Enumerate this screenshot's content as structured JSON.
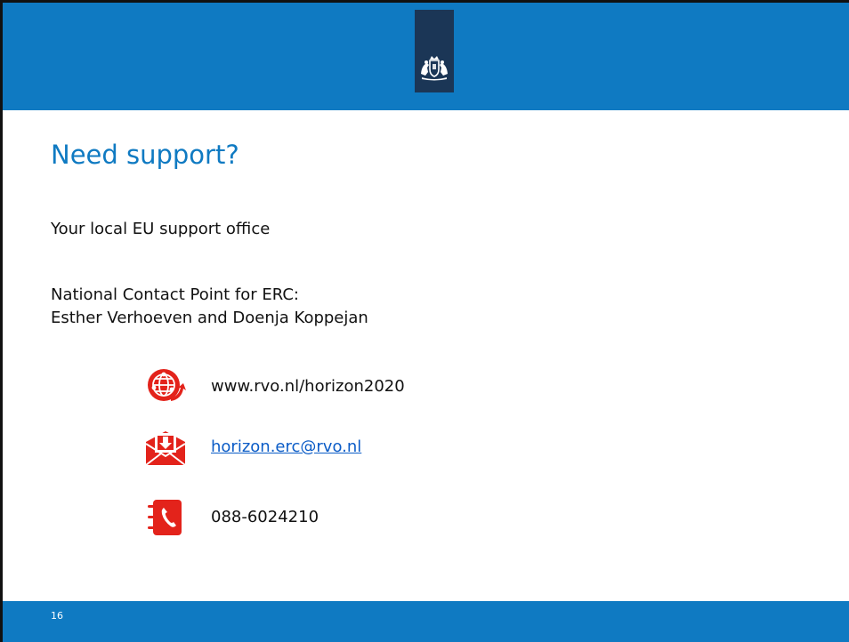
{
  "slide": {
    "title": "Need support?",
    "lines": {
      "support_office": "Your local EU support office",
      "ncp_heading": "National Contact Point for ERC:",
      "ncp_names": "Esther Verhoeven and Doenja Koppejan"
    },
    "contacts": {
      "website": "www.rvo.nl/horizon2020",
      "email": "horizon.erc@rvo.nl",
      "phone": "088-6024210"
    },
    "page_number": "16"
  },
  "colors": {
    "brand_blue": "#0f7ac2",
    "logo_navy": "#1b3656",
    "icon_red": "#e3231b",
    "link_blue": "#0b5cc7"
  },
  "icons": {
    "logo": "dutch-government-crest-icon",
    "website": "globe-icon",
    "email": "envelope-download-icon",
    "phone": "phone-book-icon"
  }
}
